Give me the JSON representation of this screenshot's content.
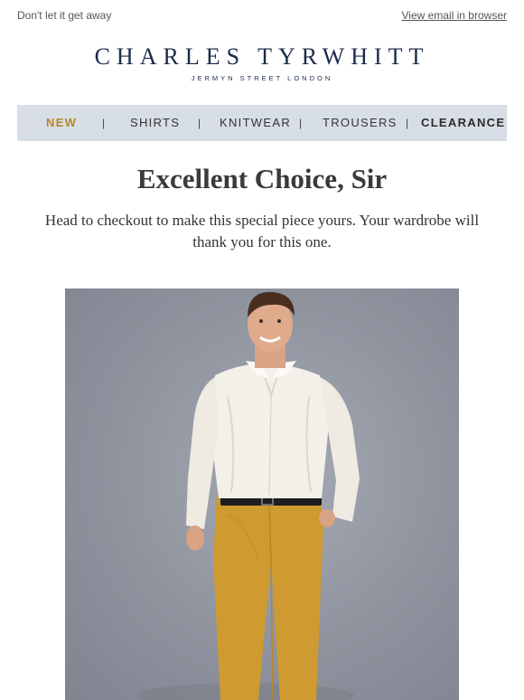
{
  "preheader": "Don't let it get away",
  "view_in_browser": "View email in browser",
  "logo": {
    "name": "CHARLES TYRWHITT",
    "tagline": "JERMYN STREET LONDON",
    "color": "#1b2b4b"
  },
  "nav": {
    "items": [
      {
        "label": "NEW",
        "highlight": true,
        "color": "#b8862a"
      },
      {
        "label": "SHIRTS"
      },
      {
        "label": "KNITWEAR"
      },
      {
        "label": "TROUSERS"
      },
      {
        "label": "CLEARANCE",
        "bold": true
      }
    ],
    "separator": "|",
    "background": "#d7dee6"
  },
  "headline": "Excellent Choice, Sir",
  "body": "Head to checkout to make this special piece yours. Your wardrobe will thank you for this one.",
  "hero": {
    "icon": "product-photo-man-white-shirt-mustard-trousers",
    "background": "#8e939e"
  }
}
